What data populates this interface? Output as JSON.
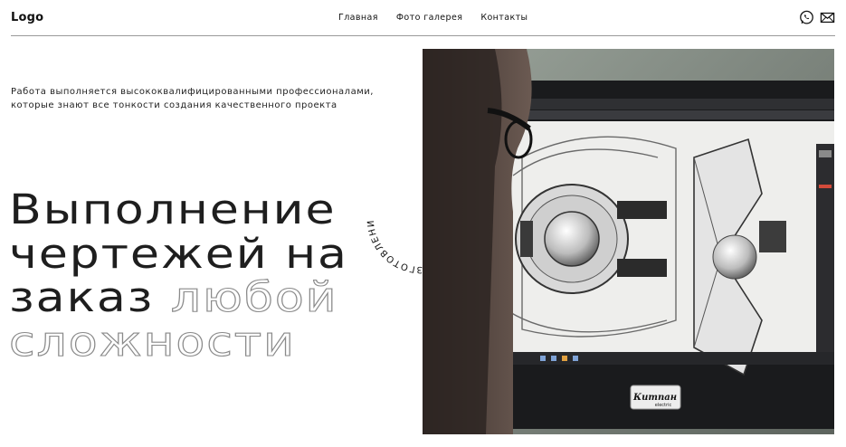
{
  "header": {
    "logo": "Logo",
    "nav": [
      "Главная",
      "Фото галерея",
      "Контакты"
    ],
    "icons": [
      "whatsapp-icon",
      "mail-icon"
    ]
  },
  "intro": {
    "line1": "Работа выполняется высококвалифицированными профессионалами,",
    "line2": "которые знают все тонкости создания качественного проекта"
  },
  "headline": {
    "line1": "Выполнение",
    "line2": "чертежей на",
    "line3_solid": "заказ",
    "line3_outline": "любой",
    "line4_outline": "сложности"
  },
  "badge": {
    "circle_text": "ИЗГОТОВЛЕНИЕ"
  },
  "photo": {
    "monitor_brand": "Китпан",
    "monitor_brand_sub": "electric"
  },
  "colors": {
    "text": "#1e1e1e",
    "outline_stroke": "#8a8a8a",
    "divider": "#9a9a9a"
  }
}
